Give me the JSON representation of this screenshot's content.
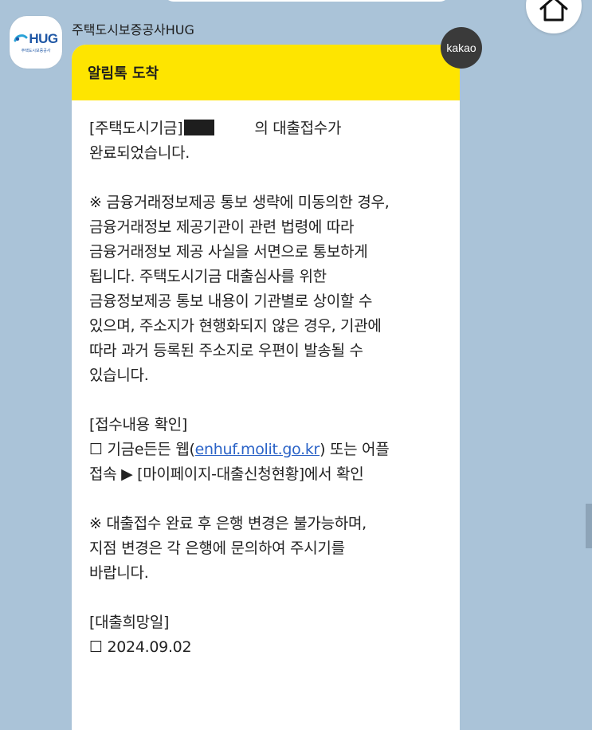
{
  "sender": {
    "name": "주택도시보증공사HUG",
    "logo_text": "HUG",
    "logo_sub": "주택도시보증공사"
  },
  "badge": {
    "label": "kakao"
  },
  "message": {
    "header_title": "알림톡 도착",
    "line1_prefix": "[주택도시기금]",
    "line1_suffix": "의 대출접수가",
    "line2": "완료되었습니다.",
    "notice1": [
      "※ 금융거래정보제공 통보 생략에 미동의한 경우,",
      "금융거래정보 제공기관이 관련 법령에 따라",
      "금융거래정보 제공 사실을 서면으로 통보하게",
      "됩니다. 주택도시기금 대출심사를 위한",
      "금융정보제공 통보 내용이 기관별로 상이할 수",
      "있으며, 주소지가 현행화되지 않은 경우, 기관에",
      "따라 과거 등록된 주소지로 우편이 발송될 수",
      "있습니다."
    ],
    "confirm_title": "[접수내용 확인]",
    "confirm_line1_prefix": "☐ 기금e든든 웹(",
    "confirm_link": "enhuf.molit.go.kr",
    "confirm_line1_suffix": ") 또는 어플",
    "confirm_line2": "접속 ▶ [마이페이지-대출신청현황]에서 확인",
    "notice2": [
      "※ 대출접수 완료 후 은행 변경은 불가능하며,",
      "지점 변경은 각 은행에 문의하여 주시기를",
      "바랍니다."
    ],
    "date_title": "[대출희망일]",
    "date_value": "☐ 2024.09.02"
  },
  "colors": {
    "background": "#aac3d8",
    "header": "#fee500",
    "link": "#2b63c7",
    "brand": "#1f57a5"
  },
  "icons": {
    "home": "home-icon",
    "logo": "hug-logo-icon"
  }
}
